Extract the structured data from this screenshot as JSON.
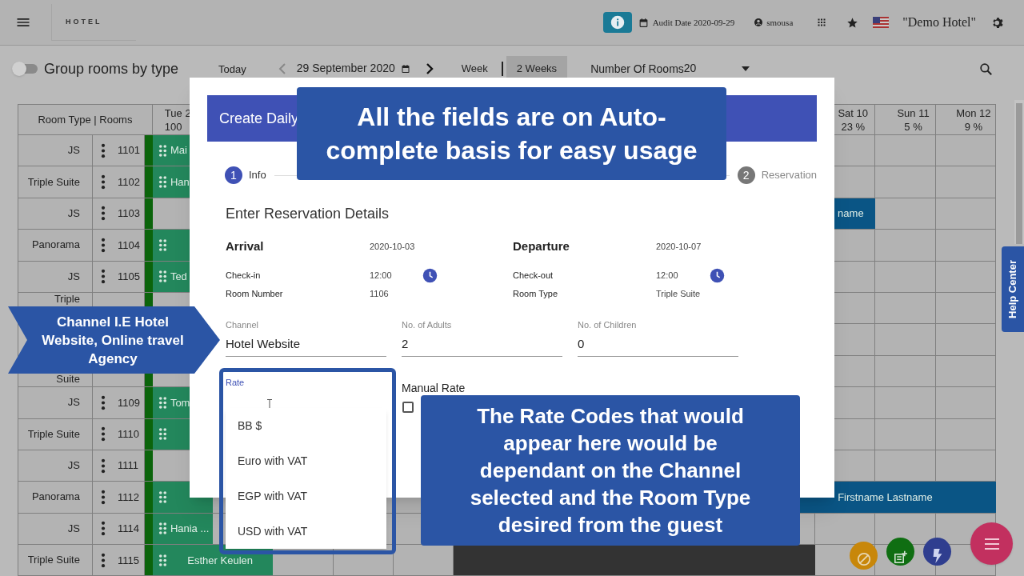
{
  "top_bar": {
    "logo": "HOTEL",
    "audit_date": "Audit Date 2020-09-29",
    "user": "smousa",
    "hotel": "\"Demo Hotel\""
  },
  "toolbar": {
    "group_toggle": {
      "label": "Group rooms by type",
      "on": false
    },
    "today": "Today",
    "date": "29 September 2020",
    "views": [
      {
        "label": "Week",
        "selected": false
      },
      {
        "label": "2 Weeks",
        "selected": true
      }
    ],
    "rooms_select": {
      "label": "Number Of Rooms",
      "value": "20"
    }
  },
  "grid": {
    "corner": "Room Type | Rooms",
    "day_headers": [
      {
        "day": "Tue 2",
        "occupancy": "100"
      },
      {
        "day": "Sat 10",
        "occupancy": "23 %"
      },
      {
        "day": "Sun 11",
        "occupancy": "5 %"
      },
      {
        "day": "Mon 12",
        "occupancy": "9 %"
      }
    ],
    "rows": [
      {
        "type": "JS",
        "room": "1101",
        "bookings": [
          {
            "label": "Mai",
            "color": "#23875c",
            "handle": true
          }
        ]
      },
      {
        "type": "Triple Suite",
        "room": "1102",
        "bookings": [
          {
            "label": "Han",
            "color": "#23875c",
            "handle": true
          }
        ]
      },
      {
        "type": "JS",
        "room": "1103",
        "bookings": [
          {
            "label": "name",
            "color": "#0a5585",
            "handle": false
          }
        ]
      },
      {
        "type": "Panorama",
        "room": "1104",
        "bookings": [
          {
            "color": "#23875c",
            "handle": true
          }
        ]
      },
      {
        "type": "JS",
        "room": "1105",
        "bookings": [
          {
            "label": "Ted",
            "color": "#23875c",
            "handle": true
          }
        ]
      },
      {
        "type": "Triple"
      },
      {
        "type": "Suite"
      },
      {
        "type": "JS",
        "room": "1109",
        "bookings": [
          {
            "label": "Tom",
            "color": "#23875c",
            "handle": true
          }
        ]
      },
      {
        "type": "Triple Suite",
        "room": "1110",
        "bookings": [
          {
            "color": "#23875c",
            "handle": true
          }
        ]
      },
      {
        "type": "JS",
        "room": "1111"
      },
      {
        "type": "Panorama",
        "room": "1112",
        "bookings": [
          {
            "color": "#23875c",
            "handle": true
          },
          {
            "label": "Firstname Lastname",
            "color": "#0a5585",
            "handle": false
          }
        ]
      },
      {
        "type": "JS",
        "room": "1114",
        "bookings": [
          {
            "label": "Hania ...",
            "color": "#23875c",
            "handle": true
          }
        ]
      },
      {
        "type": "Triple Suite",
        "room": "1115",
        "bookings": [
          {
            "label": "Esther Keulen",
            "color": "#23875c",
            "handle": true
          },
          {
            "color": "#333333",
            "handle": false
          }
        ]
      }
    ]
  },
  "dialog": {
    "title": "Create Daily",
    "steps": [
      {
        "number": "1",
        "label": "Info",
        "selected": true
      },
      {
        "number": "2",
        "label": "Reservation",
        "selected": false
      }
    ],
    "section": "Enter Reservation Details",
    "details": [
      [
        {
          "label": "Arrival",
          "value": "2020-10-03"
        },
        {
          "label": "Departure",
          "value": "2020-10-07"
        }
      ],
      [
        {
          "label": "Check-in",
          "value": "12:00",
          "time_picker": true
        },
        {
          "label": "Check-out",
          "value": "12:00",
          "time_picker": true
        }
      ],
      [
        {
          "label": "Room Number",
          "value": "1106"
        },
        {
          "label": "Room Type",
          "value": "Triple Suite"
        }
      ]
    ],
    "fields": [
      {
        "label": "Channel",
        "value": "Hotel Website"
      },
      {
        "label": "No. of Adults",
        "value": "2"
      },
      {
        "label": "No. of Children",
        "value": "0"
      }
    ],
    "rate": {
      "label": "Rate",
      "options": [
        "BB $",
        "Euro with VAT",
        "EGP with VAT",
        "USD with VAT"
      ]
    },
    "manual_rate": {
      "label": "Manual Rate",
      "checked": false
    }
  },
  "callouts": [
    {
      "kind": "box",
      "lines": [
        "All the fields are on Auto-",
        "complete basis for easy usage"
      ]
    },
    {
      "kind": "arrow",
      "lines": [
        "Channel I.E Hotel",
        "Website, Online travel",
        "Agency"
      ]
    },
    {
      "kind": "box",
      "lines": [
        "The Rate Codes that would",
        "appear here would be",
        "dependant on the Channel",
        "selected and the Room Type",
        "desired from the guest"
      ]
    }
  ],
  "help_tab": "Help Center"
}
